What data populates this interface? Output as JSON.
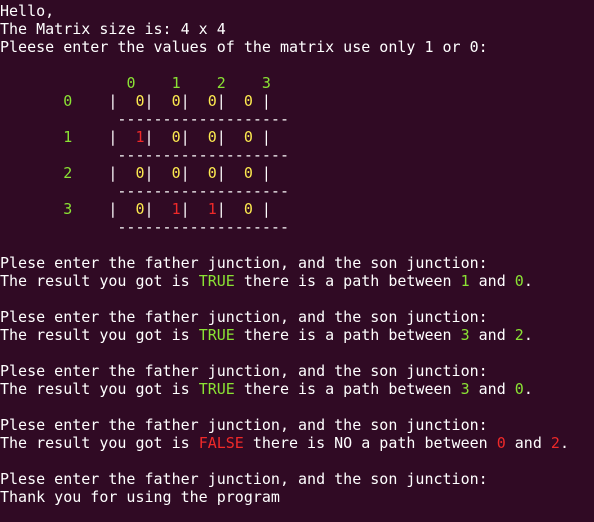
{
  "colors": {
    "background": "#300a24",
    "text": "#ffffff",
    "green": "#8ae234",
    "yellow": "#fce94f",
    "red": "#ef2929"
  },
  "lines": [
    [
      {
        "t": "Hello,",
        "c": "w"
      }
    ],
    [
      {
        "t": "The Matrix size is: 4 x 4",
        "c": "w"
      }
    ],
    [
      {
        "t": "Pleese enter the values of the matrix use only 1 or 0:",
        "c": "w"
      }
    ],
    [],
    [
      {
        "t": "              ",
        "c": "w"
      },
      {
        "t": "0",
        "c": "g"
      },
      {
        "t": "    ",
        "c": "w"
      },
      {
        "t": "1",
        "c": "g"
      },
      {
        "t": "    ",
        "c": "w"
      },
      {
        "t": "2",
        "c": "g"
      },
      {
        "t": "    ",
        "c": "w"
      },
      {
        "t": "3",
        "c": "g"
      }
    ],
    [
      {
        "t": "       ",
        "c": "w"
      },
      {
        "t": "0",
        "c": "g"
      },
      {
        "t": "    |  ",
        "c": "w"
      },
      {
        "t": "0",
        "c": "y"
      },
      {
        "t": "|  ",
        "c": "w"
      },
      {
        "t": "0",
        "c": "y"
      },
      {
        "t": "|  ",
        "c": "w"
      },
      {
        "t": "0",
        "c": "y"
      },
      {
        "t": "|  ",
        "c": "w"
      },
      {
        "t": "0",
        "c": "y"
      },
      {
        "t": " |",
        "c": "w"
      }
    ],
    [
      {
        "t": "             -------------------",
        "c": "w"
      }
    ],
    [
      {
        "t": "       ",
        "c": "w"
      },
      {
        "t": "1",
        "c": "g"
      },
      {
        "t": "    |  ",
        "c": "w"
      },
      {
        "t": "1",
        "c": "r"
      },
      {
        "t": "|  ",
        "c": "w"
      },
      {
        "t": "0",
        "c": "y"
      },
      {
        "t": "|  ",
        "c": "w"
      },
      {
        "t": "0",
        "c": "y"
      },
      {
        "t": "|  ",
        "c": "w"
      },
      {
        "t": "0",
        "c": "y"
      },
      {
        "t": " |",
        "c": "w"
      }
    ],
    [
      {
        "t": "             -------------------",
        "c": "w"
      }
    ],
    [
      {
        "t": "       ",
        "c": "w"
      },
      {
        "t": "2",
        "c": "g"
      },
      {
        "t": "    |  ",
        "c": "w"
      },
      {
        "t": "0",
        "c": "y"
      },
      {
        "t": "|  ",
        "c": "w"
      },
      {
        "t": "0",
        "c": "y"
      },
      {
        "t": "|  ",
        "c": "w"
      },
      {
        "t": "0",
        "c": "y"
      },
      {
        "t": "|  ",
        "c": "w"
      },
      {
        "t": "0",
        "c": "y"
      },
      {
        "t": " |",
        "c": "w"
      }
    ],
    [
      {
        "t": "             -------------------",
        "c": "w"
      }
    ],
    [
      {
        "t": "       ",
        "c": "w"
      },
      {
        "t": "3",
        "c": "g"
      },
      {
        "t": "    |  ",
        "c": "w"
      },
      {
        "t": "0",
        "c": "y"
      },
      {
        "t": "|  ",
        "c": "w"
      },
      {
        "t": "1",
        "c": "r"
      },
      {
        "t": "|  ",
        "c": "w"
      },
      {
        "t": "1",
        "c": "r"
      },
      {
        "t": "|  ",
        "c": "w"
      },
      {
        "t": "0",
        "c": "y"
      },
      {
        "t": " |",
        "c": "w"
      }
    ],
    [
      {
        "t": "             -------------------",
        "c": "w"
      }
    ],
    [],
    [
      {
        "t": "Plese enter the father junction, and the son junction:",
        "c": "w"
      }
    ],
    [
      {
        "t": "The result you got is ",
        "c": "w"
      },
      {
        "t": "TRUE",
        "c": "g"
      },
      {
        "t": " there is a path between ",
        "c": "w"
      },
      {
        "t": "1",
        "c": "g"
      },
      {
        "t": " and ",
        "c": "w"
      },
      {
        "t": "0",
        "c": "g"
      },
      {
        "t": ".",
        "c": "w"
      }
    ],
    [],
    [
      {
        "t": "Plese enter the father junction, and the son junction:",
        "c": "w"
      }
    ],
    [
      {
        "t": "The result you got is ",
        "c": "w"
      },
      {
        "t": "TRUE",
        "c": "g"
      },
      {
        "t": " there is a path between ",
        "c": "w"
      },
      {
        "t": "3",
        "c": "g"
      },
      {
        "t": " and ",
        "c": "w"
      },
      {
        "t": "2",
        "c": "g"
      },
      {
        "t": ".",
        "c": "w"
      }
    ],
    [],
    [
      {
        "t": "Plese enter the father junction, and the son junction:",
        "c": "w"
      }
    ],
    [
      {
        "t": "The result you got is ",
        "c": "w"
      },
      {
        "t": "TRUE",
        "c": "g"
      },
      {
        "t": " there is a path between ",
        "c": "w"
      },
      {
        "t": "3",
        "c": "g"
      },
      {
        "t": " and ",
        "c": "w"
      },
      {
        "t": "0",
        "c": "g"
      },
      {
        "t": ".",
        "c": "w"
      }
    ],
    [],
    [
      {
        "t": "Plese enter the father junction, and the son junction:",
        "c": "w"
      }
    ],
    [
      {
        "t": "The result you got is ",
        "c": "w"
      },
      {
        "t": "FALSE",
        "c": "r"
      },
      {
        "t": " there is NO a path between ",
        "c": "w"
      },
      {
        "t": "0",
        "c": "r"
      },
      {
        "t": " and ",
        "c": "w"
      },
      {
        "t": "2",
        "c": "r"
      },
      {
        "t": ".",
        "c": "w"
      }
    ],
    [],
    [
      {
        "t": "Plese enter the father junction, and the son junction:",
        "c": "w"
      }
    ],
    [
      {
        "t": "Thank you for using the program",
        "c": "w"
      }
    ]
  ]
}
